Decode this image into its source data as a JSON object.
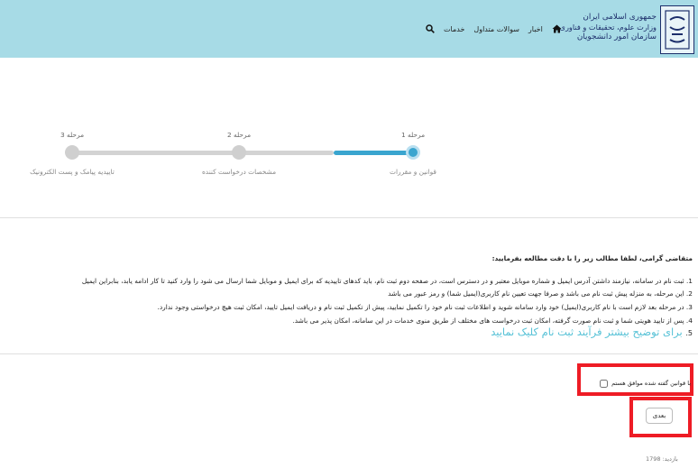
{
  "header": {
    "logo_lines": [
      "جمهوری اسلامی ایران",
      "وزارت علوم، تحقیقات و فناوری",
      "سازمان امور دانشجویان"
    ],
    "nav": {
      "news": "اخبار",
      "faq": "سوالات متداول",
      "services": "خدمات"
    }
  },
  "wizard": {
    "steps": [
      {
        "label": "مرحله 1",
        "sub": "قوانین و مقررات"
      },
      {
        "label": "مرحله 2",
        "sub": "مشخصات درخواست کننده"
      },
      {
        "label": "مرحله 3",
        "sub": "تاییدیه پیامک و پست الکترونیک"
      }
    ],
    "current_step": 1,
    "colors": {
      "active": "#3aa5cf",
      "inactive": "#d3d3d3"
    }
  },
  "rules": {
    "heading": "متقاضی گرامی، لطفا مطالب زیر را با دقت مطالعه بفرمایید:",
    "items": [
      "1. ثبت نام در سامانه، نیازمند داشتن آدرس ایمیل و شماره موبایل معتبر و در دسترس است، در صفحه دوم ثبت نام، باید کدهای تاییدیه که برای ایمیل و موبایل شما ارسال می شود را وارد کنید تا کار ادامه یابد، بنابراین ایمیل",
      "2. این مرحله، به منزله پیش ثبت نام می باشد و صرفا جهت تعیین نام کاربری(ایمیل شما) و رمز عبور می باشد",
      "3. در مرحله بعد لازم است با نام کاربری(ایمیل) خود وارد سامانه شوید و اطلاعات ثبت نام خود را تکمیل نمایید، پیش از تکمیل ثبت نام و دریافت ایمیل تایید، امکان ثبت هیچ درخواستی وجود ندارد.",
      "4. پس از تایید هویتی شما و ثبت نام صورت گرفته، امکان ثبت درخواست های مختلف از طریق منوی خدمات در این سامانه، امکان پذیر می باشد."
    ],
    "link_number": "5.",
    "link_text": "برای توضیح بیشتر فرآیند ثبت نام کلیک نمایید"
  },
  "agree": {
    "label": "با قوانین گفته شده موافق هستم",
    "checked": false
  },
  "next_label": "بعدی",
  "visits": "بازدید: 1798"
}
